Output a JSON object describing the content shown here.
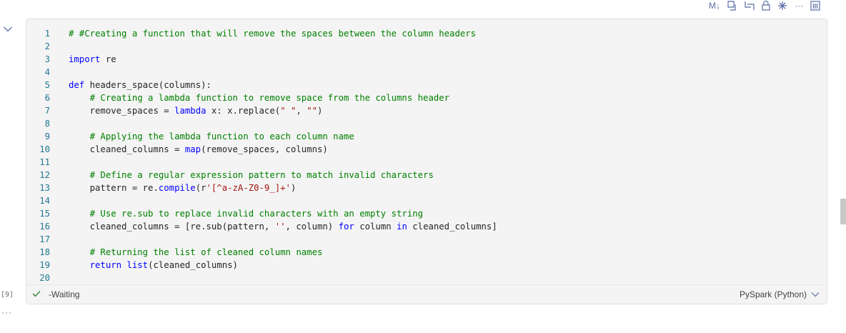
{
  "toolbar": {
    "markdown_label": "M↓",
    "more_label": "···"
  },
  "cell": {
    "execution_count": "[9]",
    "status_text": "-Waiting",
    "kernel": "PySpark (Python)",
    "code_lines": [
      {
        "n": "1",
        "tokens": [
          {
            "t": "# #Creating a function that will remove the spaces between the column headers",
            "c": "cm"
          }
        ]
      },
      {
        "n": "2",
        "tokens": []
      },
      {
        "n": "3",
        "tokens": [
          {
            "t": "import",
            "c": "kw"
          },
          {
            "t": " re",
            "c": ""
          }
        ]
      },
      {
        "n": "4",
        "tokens": []
      },
      {
        "n": "5",
        "tokens": [
          {
            "t": "def",
            "c": "kw"
          },
          {
            "t": " headers_space(columns):",
            "c": ""
          }
        ]
      },
      {
        "n": "6",
        "tokens": [
          {
            "t": "    ",
            "c": ""
          },
          {
            "t": "# Creating a lambda function to remove space from the columns header",
            "c": "cm"
          }
        ]
      },
      {
        "n": "7",
        "tokens": [
          {
            "t": "    remove_spaces = ",
            "c": ""
          },
          {
            "t": "lambda",
            "c": "kw"
          },
          {
            "t": " x: x.replace(",
            "c": ""
          },
          {
            "t": "\" \"",
            "c": "st"
          },
          {
            "t": ", ",
            "c": ""
          },
          {
            "t": "\"\"",
            "c": "st"
          },
          {
            "t": ")",
            "c": ""
          }
        ]
      },
      {
        "n": "8",
        "tokens": []
      },
      {
        "n": "9",
        "tokens": [
          {
            "t": "    ",
            "c": ""
          },
          {
            "t": "# Applying the lambda function to each column name",
            "c": "cm"
          }
        ]
      },
      {
        "n": "10",
        "tokens": [
          {
            "t": "    cleaned_columns = ",
            "c": ""
          },
          {
            "t": "map",
            "c": "kw"
          },
          {
            "t": "(remove_spaces, columns)",
            "c": ""
          }
        ]
      },
      {
        "n": "11",
        "tokens": []
      },
      {
        "n": "12",
        "tokens": [
          {
            "t": "    ",
            "c": ""
          },
          {
            "t": "# Define a regular expression pattern to match invalid characters",
            "c": "cm"
          }
        ]
      },
      {
        "n": "13",
        "tokens": [
          {
            "t": "    pattern = re.",
            "c": ""
          },
          {
            "t": "compile",
            "c": "kw"
          },
          {
            "t": "(r",
            "c": ""
          },
          {
            "t": "'[^a-zA-Z0-9_]+'",
            "c": "st"
          },
          {
            "t": ")",
            "c": ""
          }
        ]
      },
      {
        "n": "14",
        "tokens": []
      },
      {
        "n": "15",
        "tokens": [
          {
            "t": "    ",
            "c": ""
          },
          {
            "t": "# Use re.sub to replace invalid characters with an empty string",
            "c": "cm"
          }
        ]
      },
      {
        "n": "16",
        "tokens": [
          {
            "t": "    cleaned_columns = [re.sub(pattern, ",
            "c": ""
          },
          {
            "t": "''",
            "c": "st"
          },
          {
            "t": ", column) ",
            "c": ""
          },
          {
            "t": "for",
            "c": "kw"
          },
          {
            "t": " column ",
            "c": ""
          },
          {
            "t": "in",
            "c": "kw"
          },
          {
            "t": " cleaned_columns]",
            "c": ""
          }
        ]
      },
      {
        "n": "17",
        "tokens": []
      },
      {
        "n": "18",
        "tokens": [
          {
            "t": "    ",
            "c": ""
          },
          {
            "t": "# Returning the list of cleaned column names",
            "c": "cm"
          }
        ]
      },
      {
        "n": "19",
        "tokens": [
          {
            "t": "    ",
            "c": ""
          },
          {
            "t": "return",
            "c": "kw"
          },
          {
            "t": " ",
            "c": ""
          },
          {
            "t": "list",
            "c": "kw"
          },
          {
            "t": "(cleaned_columns)",
            "c": ""
          }
        ]
      },
      {
        "n": "20",
        "tokens": []
      }
    ]
  },
  "below_cell": {
    "more_label": "···"
  },
  "icons": {
    "toolbar": [
      "markdown-icon",
      "run-above-icon",
      "run-below-icon",
      "lock-icon",
      "freeze-icon",
      "more-icon",
      "delete-icon"
    ],
    "cell": [
      "collapse-chevron-icon",
      "check-icon",
      "chevron-down-icon"
    ]
  },
  "colors": {
    "keyword": "#0000ff",
    "comment": "#008000",
    "string": "#a31515",
    "line_number": "#237893",
    "toolbar_icon": "#5b6ea8",
    "cell_background": "#f4f4f4"
  }
}
